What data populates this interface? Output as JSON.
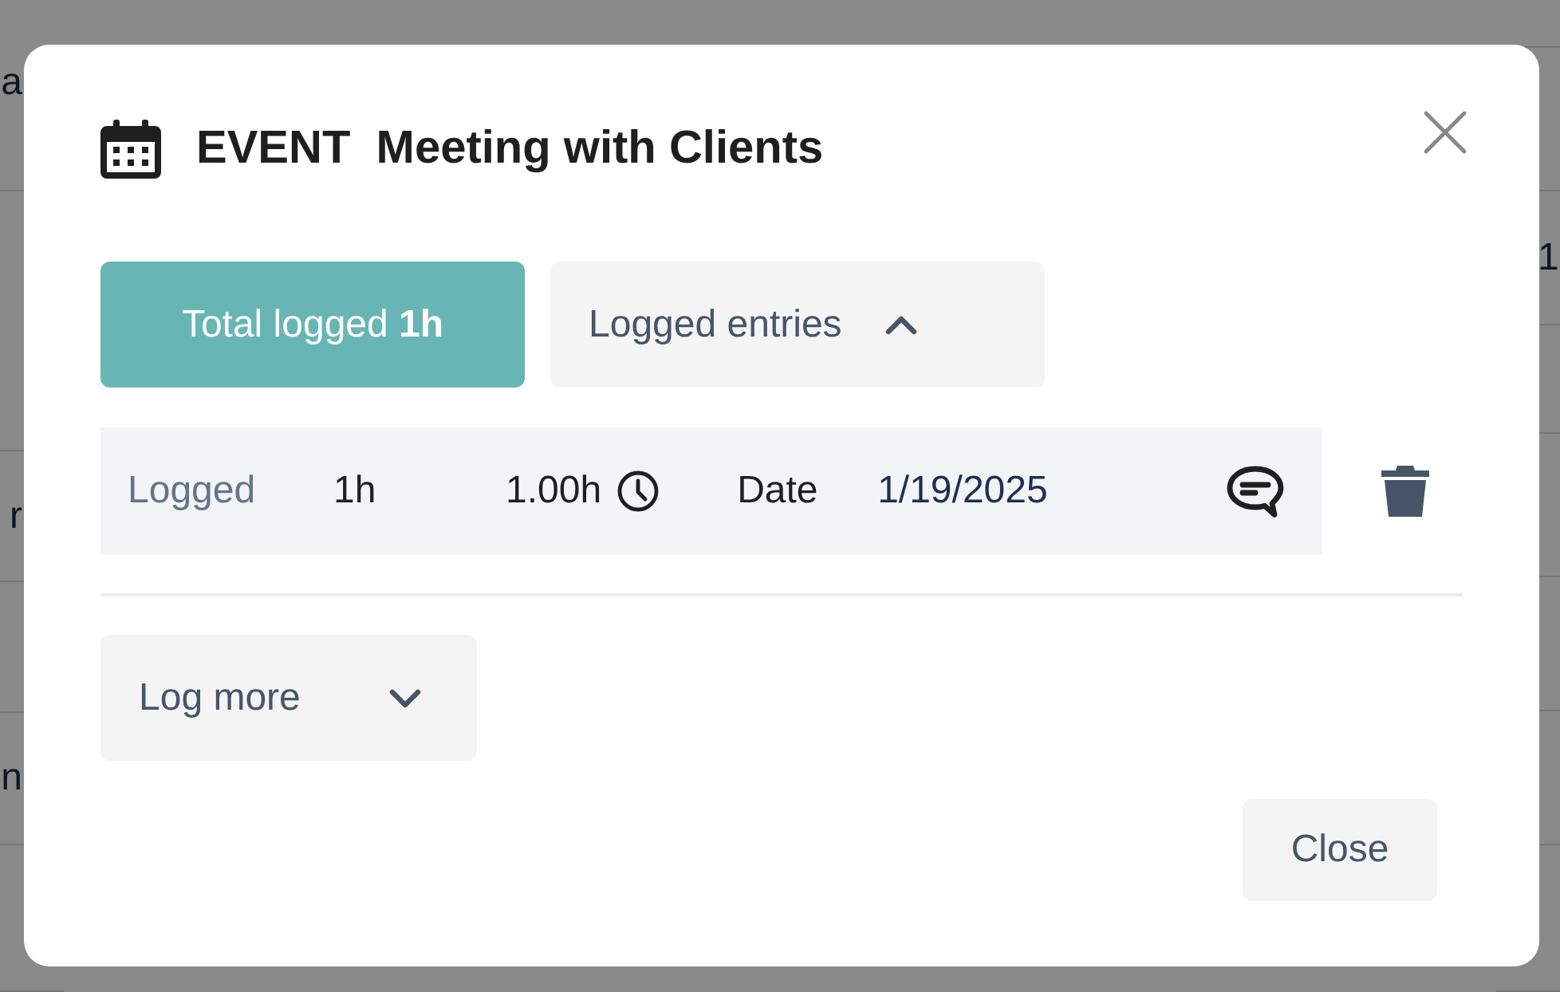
{
  "background": {
    "left_fragments": [
      "a",
      "r",
      "n"
    ],
    "right_fragments": [
      "1"
    ]
  },
  "dialog": {
    "type_label": "EVENT",
    "title": "Meeting with Clients"
  },
  "summary": {
    "text": "Total logged **1h**"
  },
  "entries_toggle": {
    "label": "Logged entries",
    "expanded": true
  },
  "entries": [
    {
      "logged_label": "Logged",
      "logged": "1h",
      "hours": "1.00h",
      "date_label": "Date",
      "date": "1/19/2025"
    }
  ],
  "log_more": {
    "label": "Log more",
    "expanded": false
  },
  "close_button": "Close"
}
